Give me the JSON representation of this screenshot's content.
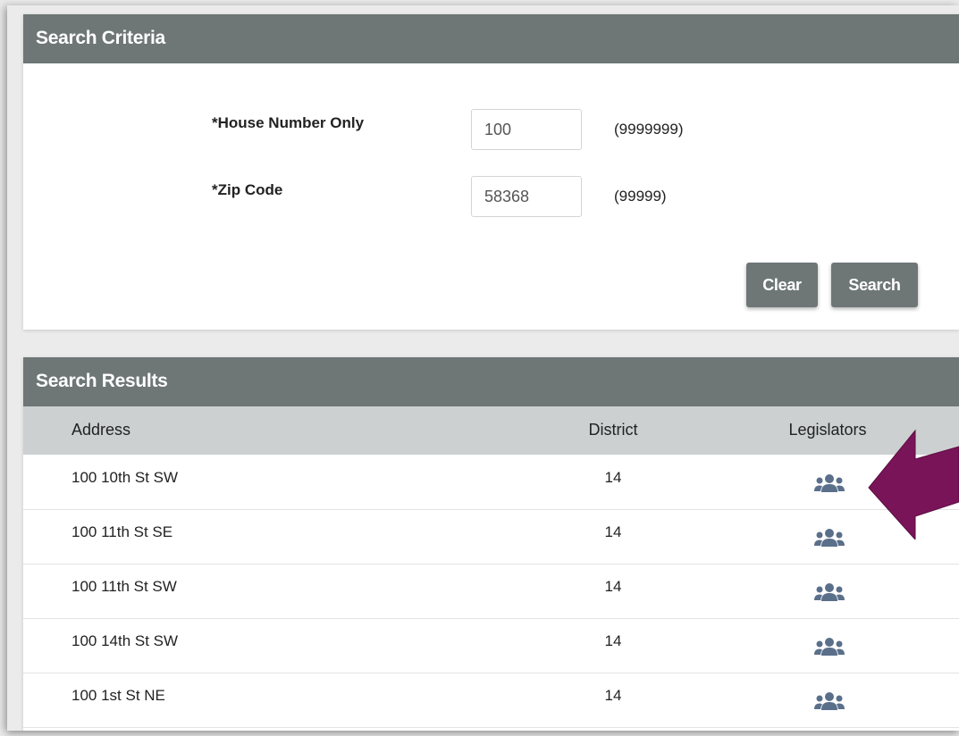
{
  "search_criteria": {
    "title": "Search Criteria",
    "house_number": {
      "label": "*House Number Only",
      "value": "100",
      "hint": "(9999999)"
    },
    "zip_code": {
      "label": "*Zip Code",
      "value": "58368",
      "hint": "(99999)"
    },
    "clear_label": "Clear",
    "search_label": "Search"
  },
  "search_results": {
    "title": "Search Results",
    "columns": {
      "address": "Address",
      "district": "District",
      "legislators": "Legislators"
    },
    "rows": [
      {
        "address": "100 10th St SW",
        "district": "14",
        "icon": "legislators-group-icon"
      },
      {
        "address": "100 11th St SE",
        "district": "14",
        "icon": "legislators-group-icon"
      },
      {
        "address": "100 11th St SW",
        "district": "14",
        "icon": "legislators-group-icon"
      },
      {
        "address": "100 14th St SW",
        "district": "14",
        "icon": "legislators-group-icon"
      },
      {
        "address": "100 1st St NE",
        "district": "14",
        "icon": "legislators-group-icon"
      }
    ]
  },
  "colors": {
    "header_bg": "#6e7676",
    "table_head_bg": "#ccd0d0",
    "icon_color": "#5a6f8a",
    "arrow_color": "#7a1458"
  }
}
